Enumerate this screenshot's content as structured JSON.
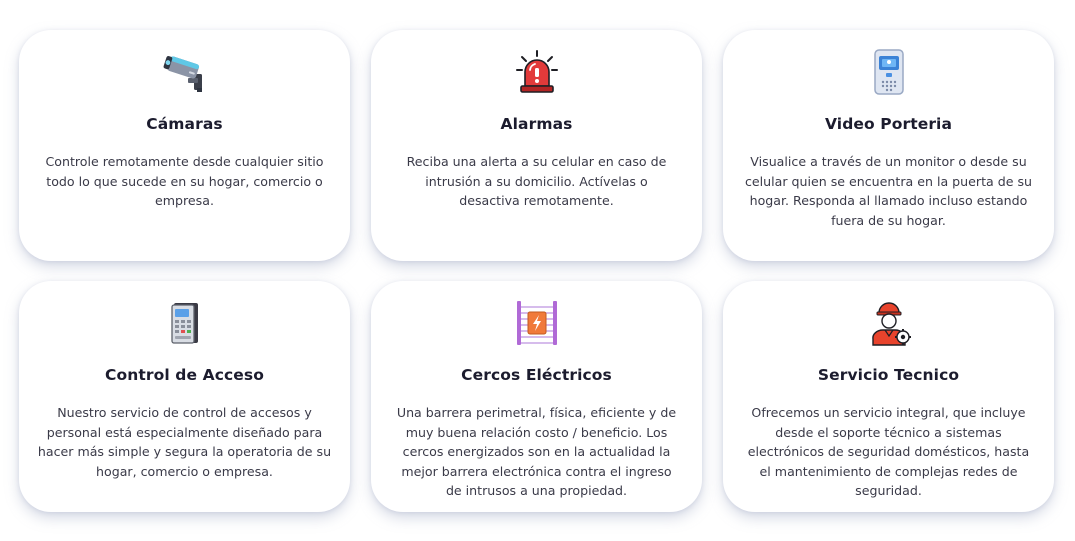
{
  "cards": [
    {
      "icon": "security-camera-icon",
      "title": "Cámaras",
      "description": "Controle remotamente desde cualquier sitio\ntodo lo que sucede en su hogar, comercio o\nempresa."
    },
    {
      "icon": "alarm-siren-icon",
      "title": "Alarmas",
      "description": "Reciba una alerta a su celular en caso de\nintrusión a su domicilio. Actívelas o\ndesactiva remotamente."
    },
    {
      "icon": "video-intercom-icon",
      "title": "Video Porteria",
      "description": "Visualice a través de un monitor o desde su\ncelular quien se encuentra en la puerta de su\nhogar. Responda al llamado incluso estando\nfuera de su hogar."
    },
    {
      "icon": "access-keypad-icon",
      "title": "Control de Acceso",
      "description": "Nuestro servicio de control de accesos y\npersonal está especialmente diseñado para\nhacer más simple y segura la operatoria de su\nhogar, comercio o empresa."
    },
    {
      "icon": "electric-fence-icon",
      "title": "Cercos Eléctricos",
      "description": "Una barrera perimetral, física, eficiente y de\nmuy buena relación costo / beneficio. Los\ncercos energizados son en la actualidad la\nmejor barrera electrónica contra el ingreso\nde intrusos a una propiedad."
    },
    {
      "icon": "technician-icon",
      "title": "Servicio Tecnico",
      "description": "Ofrecemos un servicio integral, que incluye\ndesde el soporte técnico a sistemas\nelectrónicos de seguridad domésticos, hasta\nel mantenimiento de complejas redes de\nseguridad."
    }
  ]
}
